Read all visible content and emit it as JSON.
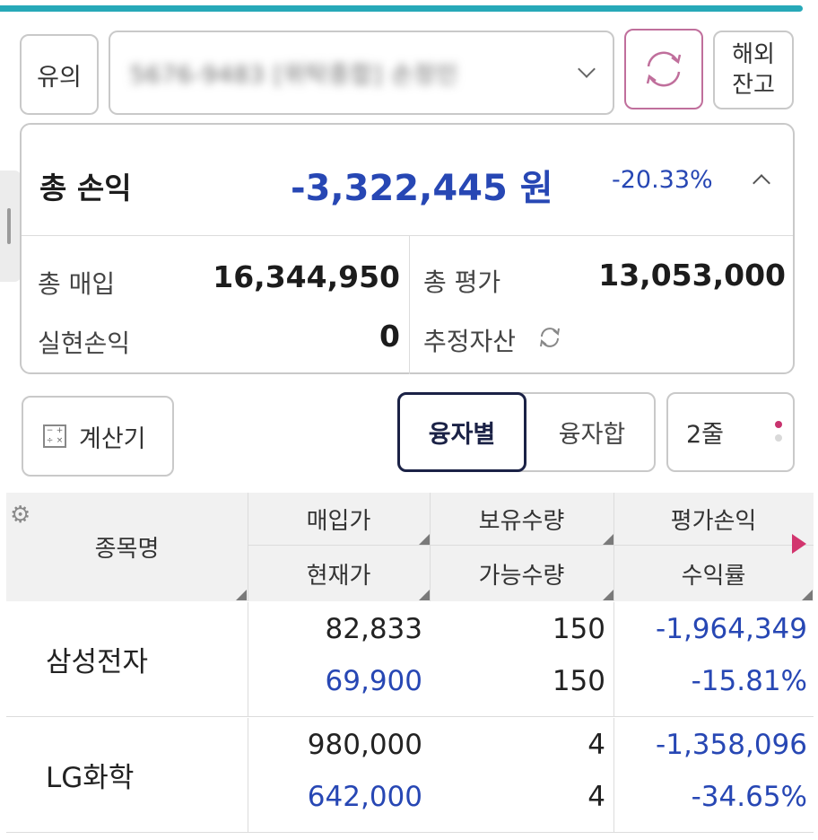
{
  "toolbar": {
    "caution_label": "유의",
    "account_value": "5676-9483 [위탁종합] 손정인",
    "overseas_label_line1": "해외",
    "overseas_label_line2": "잔고"
  },
  "summary": {
    "title": "총 손익",
    "total_pl": "-3,322,445",
    "total_pl_unit": "원",
    "total_pl_rate": "-20.33%",
    "buy_label": "총 매입",
    "buy_value": "16,344,950",
    "eval_label": "총 평가",
    "eval_value": "13,053,000",
    "realized_label": "실현손익",
    "realized_value": "0",
    "est_assets_label": "추정자산"
  },
  "controls": {
    "calculator_label": "계산기",
    "seg_by_loan": "융자별",
    "seg_loan_total": "융자합",
    "rows_label": "2줄"
  },
  "table": {
    "headers": {
      "name": "종목명",
      "buy_price": "매입가",
      "holding_qty": "보유수량",
      "eval_pl": "평가손익",
      "current_price": "현재가",
      "available_qty": "가능수량",
      "return_rate": "수익률"
    },
    "rows": [
      {
        "name": "삼성전자",
        "buy_price": "82,833",
        "current_price": "69,900",
        "holding_qty": "150",
        "available_qty": "150",
        "eval_pl": "-1,964,349",
        "return_rate": "-15.81%"
      },
      {
        "name": "LG화학",
        "buy_price": "980,000",
        "current_price": "642,000",
        "holding_qty": "4",
        "available_qty": "4",
        "eval_pl": "-1,358,096",
        "return_rate": "-34.65%"
      }
    ]
  },
  "colors": {
    "accent_top": "#27a9b8",
    "loss_blue": "#2747b4",
    "refresh_border": "#c06f9c",
    "active_segment": "#1b2246"
  }
}
